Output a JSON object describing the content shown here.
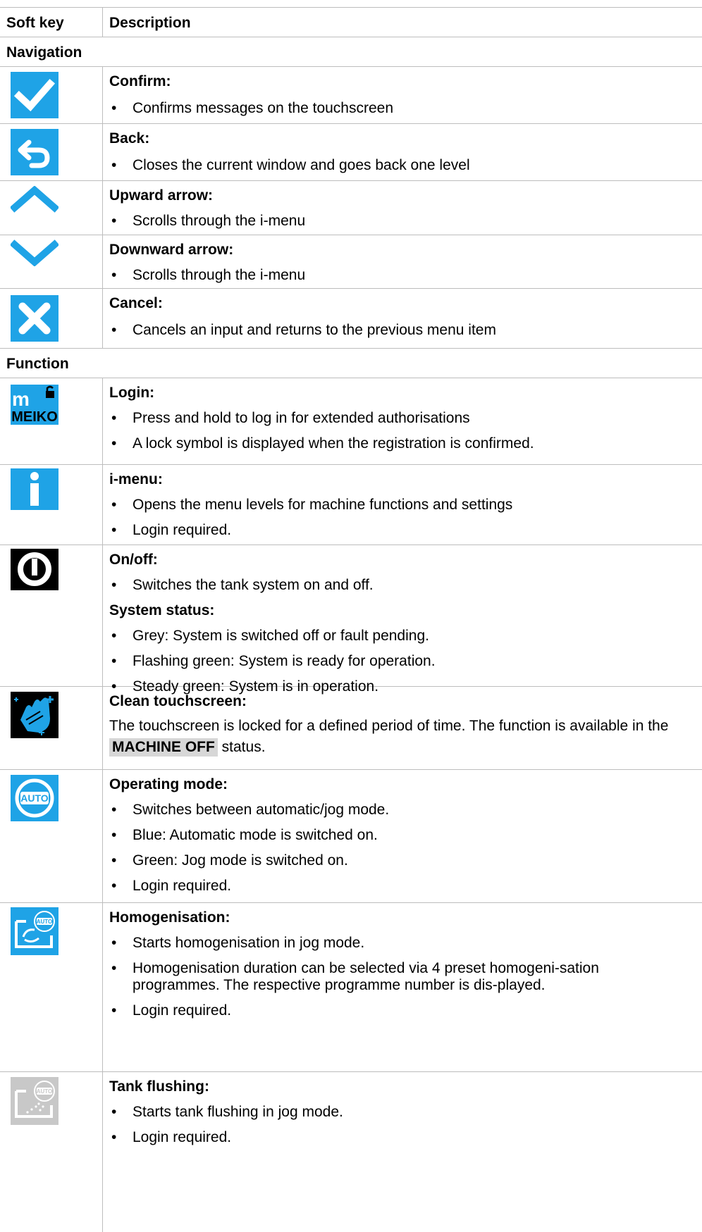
{
  "header": {
    "col1": "Soft key",
    "col2": "Description"
  },
  "sections": {
    "navigation": "Navigation",
    "function": "Function"
  },
  "colors": {
    "blue": "#1fa3e6",
    "black": "#000000",
    "grey": "#c8c8c8",
    "border": "#bdbdbd",
    "highlight": "#d7d7d7"
  },
  "rows": {
    "confirm": {
      "icon": "checkmark-icon",
      "title": "Confirm:",
      "b1": "Confirms messages on the touchscreen"
    },
    "back": {
      "icon": "back-arrow-icon",
      "title": "Back:",
      "b1": "Closes the current window and goes back one level"
    },
    "up": {
      "icon": "chevron-up-icon",
      "title": "Upward arrow:",
      "b1": "Scrolls through the i-menu"
    },
    "down": {
      "icon": "chevron-down-icon",
      "title": "Downward arrow:",
      "b1": "Scrolls through the i-menu"
    },
    "cancel": {
      "icon": "close-icon",
      "title": "Cancel:",
      "b1": "Cancels an input and returns to the previous menu item"
    },
    "login": {
      "icon": "meiko-login-icon",
      "logo_top": "m",
      "logo_text": "MEIKO",
      "title": "Login:",
      "b1": "Press and hold to log in for extended authorisations",
      "b2": "A lock symbol is displayed when the registration is confirmed."
    },
    "imenu": {
      "icon": "info-icon",
      "title": "i-menu:",
      "b1": "Opens the menu levels for machine functions and settings",
      "b2": "Login required."
    },
    "onoff": {
      "icon": "power-icon",
      "title": "On/off:",
      "b1": "Switches the tank system on and off.",
      "title2": "System status:",
      "b2": "Grey: System is switched off or fault pending.",
      "b3": "Flashing green: System is ready for operation.",
      "b4": "Steady green: System is in operation."
    },
    "clean": {
      "icon": "clean-touchscreen-icon",
      "title": "Clean touchscreen:",
      "p1": "The touchscreen is locked for a defined period of time. The function is available in the",
      "status": "MACHINE OFF",
      "p2": "status."
    },
    "opmode": {
      "icon": "auto-mode-icon",
      "icon_text": "AUTO",
      "title": "Operating mode:",
      "b1": "Switches between automatic/jog mode.",
      "b2": "Blue: Automatic mode is switched on.",
      "b3": "Green: Jog mode is switched on.",
      "b4": "Login required."
    },
    "homog": {
      "icon": "homogenisation-icon",
      "icon_text": "AUTO",
      "title": "Homogenisation:",
      "b1": "Starts homogenisation in jog mode.",
      "b2": "Homogenisation duration can be selected via 4 preset homogeni-sation programmes. The respective programme number is dis-played.",
      "b3": "Login required."
    },
    "flush": {
      "icon": "tank-flushing-icon",
      "icon_text": "AUTO",
      "title": "Tank flushing:",
      "b1": "Starts tank flushing in jog mode.",
      "b2": "Login required."
    }
  }
}
